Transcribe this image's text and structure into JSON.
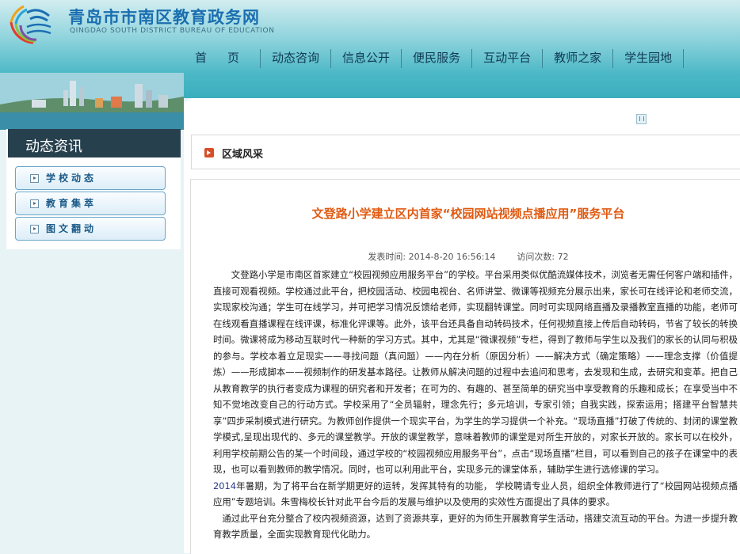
{
  "header": {
    "title": "青岛市市南区教育政务网",
    "subtitle": "QINGDAO SOUTH DISTRICT BUREAU OF EDUCATION"
  },
  "nav": [
    {
      "label": "首页"
    },
    {
      "label": "动态咨询"
    },
    {
      "label": "信息公开"
    },
    {
      "label": "便民服务"
    },
    {
      "label": "互动平台"
    },
    {
      "label": "教师之家"
    },
    {
      "label": "学生园地"
    }
  ],
  "sidebar": {
    "title": "动态资讯",
    "items": [
      {
        "label": "学校动态"
      },
      {
        "label": "教育集萃"
      },
      {
        "label": "图文翻动"
      }
    ]
  },
  "breadcrumb": {
    "label": "区域风采"
  },
  "article": {
    "title": "文登路小学建立区内首家“校园网站视频点播应用”服务平台",
    "publish_label": "发表时间:",
    "publish_time": "2014-8-20 16:56:14",
    "visits_label": "访问次数:",
    "visits": "72",
    "para1": "文登路小学是市南区首家建立“校园视频应用服务平台”的学校。平台采用类似优酷流媒体技术，浏览者无需任何客户端和插件，直接可观看视频。学校通过此平台，把校园活动、校园电视台、名师讲堂、微课等视频充分展示出来，家长可在线评论和老师交流，实现家校沟通；学生可在线学习，并可把学习情况反馈给老师，实现翻转课堂。同时可实现网络直播及录播教室直播的功能，老师可在线观看直播课程在线评课，标准化评课等。此外，该平台还具备自动转码技术，任何视频直接上传后自动转码，节省了较长的转换时间。微课将成为移动互联时代一种新的学习方式。其中，尤其是“微课视频”专栏，得到了教师与学生以及我们的家长的认同与积极的参与。学校本着立足现实——寻找问题（真问题）——内在分析（原因分析）——解决方式（确定策略）——理念支撑（价值提炼）——形成脚本——视频制作的研发基本路径。让教师从解决问题的过程中去追问和思考，去发现和生成，去研究和变革。把自己从教育教学的执行者变成为课程的研究者和开发者；在可为的、有趣的、甚至简单的研究当中享受教育的乐趣和成长；在享受当中不知不觉地改变自己的行动方式。学校采用了“全员辐射，理念先行；多元培训，专家引领；自我实践，探索运用；搭建平台智慧共享”四步采制模式进行研究。为教师创作提供一个现实平台，为学生的学习提供一个补充。“现场直播”打破了传统的、封闭的课堂教学模式,呈现出现代的、多元的课堂教学。开放的课堂教学，意味着教师的课堂是对所生开放的，对家长开放的。家长可以在校外，利用学校前期公告的某一个时间段，通过学校的“校园视频应用服务平台”，点击“现场直播”栏目，可以看到自己的孩子在课堂中的表现，也可以看到教师的教学情况。同时，也可以利用此平台，实现多元的课堂体系，辅助学生进行选修课的学习。",
    "para2_year": "2014",
    "para2": "年暑期，为了将平台在新学期更好的运转，发挥其特有的功能， 学校聘请专业人员，组织全体教师进行了“校园网站视频点播应用”专题培训。朱雪梅校长针对此平台今后的发展与维护以及使用的实效性方面提出了具体的要求。",
    "para3": "通过此平台充分整合了校内视频资源，达到了资源共享，更好的为师生开展教育学生活动，搭建交流互动的平台。为进一步提升教育教学质量，全面实现教育现代化助力。"
  }
}
